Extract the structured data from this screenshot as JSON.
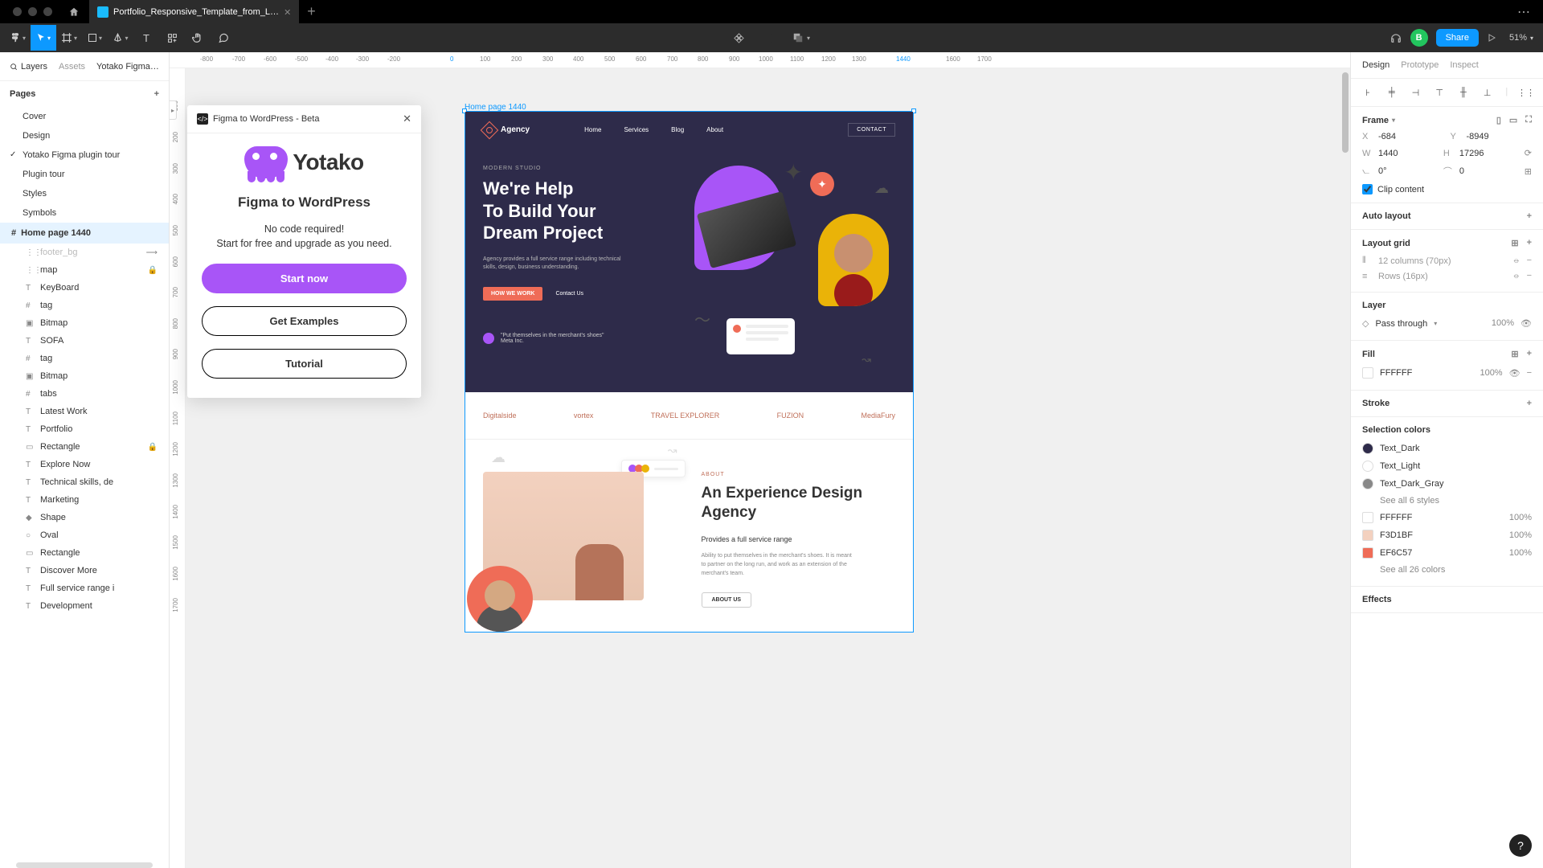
{
  "tabs": {
    "file_name": "Portfolio_Responsive_Template_from_L…"
  },
  "toolbar": {
    "share": "Share",
    "zoom": "51%",
    "avatar": "B"
  },
  "left": {
    "tab_layers": "Layers",
    "tab_assets": "Assets",
    "doc_name": "Yotako Figma p…",
    "pages_label": "Pages",
    "pages": [
      "Cover",
      "Design",
      "Yotako Figma plugin tour",
      "Plugin tour",
      "Styles",
      "Symbols"
    ],
    "frame": "Home page 1440",
    "layers": [
      {
        "icon": "⋮⋮",
        "name": "footer_bg",
        "dim": true,
        "flag": "⟶"
      },
      {
        "icon": "⋮⋮",
        "name": "map",
        "lock": true
      },
      {
        "icon": "T",
        "name": "KeyBoard"
      },
      {
        "icon": "#",
        "name": "tag"
      },
      {
        "icon": "▣",
        "name": "Bitmap"
      },
      {
        "icon": "T",
        "name": "SOFA"
      },
      {
        "icon": "#",
        "name": "tag"
      },
      {
        "icon": "▣",
        "name": "Bitmap"
      },
      {
        "icon": "#",
        "name": "tabs"
      },
      {
        "icon": "T",
        "name": "Latest Work"
      },
      {
        "icon": "T",
        "name": "Portfolio"
      },
      {
        "icon": "▭",
        "name": "Rectangle",
        "lock": true
      },
      {
        "icon": "T",
        "name": "Explore Now"
      },
      {
        "icon": "T",
        "name": "Technical skills, de"
      },
      {
        "icon": "T",
        "name": "Marketing"
      },
      {
        "icon": "◆",
        "name": "Shape"
      },
      {
        "icon": "○",
        "name": "Oval"
      },
      {
        "icon": "▭",
        "name": "Rectangle"
      },
      {
        "icon": "T",
        "name": "Discover More"
      },
      {
        "icon": "T",
        "name": "Full service range i"
      },
      {
        "icon": "T",
        "name": "Development"
      }
    ]
  },
  "ruler_h": [
    {
      "v": "-800",
      "p": 38
    },
    {
      "v": "-700",
      "p": 78
    },
    {
      "v": "-600",
      "p": 117
    },
    {
      "v": "-500",
      "p": 156
    },
    {
      "v": "-400",
      "p": 194
    },
    {
      "v": "-300",
      "p": 232
    },
    {
      "v": "-200",
      "p": 271
    },
    {
      "v": "0",
      "p": 349,
      "sel": true
    },
    {
      "v": "100",
      "p": 386
    },
    {
      "v": "200",
      "p": 425
    },
    {
      "v": "300",
      "p": 464
    },
    {
      "v": "400",
      "p": 502
    },
    {
      "v": "500",
      "p": 541
    },
    {
      "v": "600",
      "p": 580
    },
    {
      "v": "700",
      "p": 619
    },
    {
      "v": "800",
      "p": 657
    },
    {
      "v": "900",
      "p": 696
    },
    {
      "v": "1000",
      "p": 733
    },
    {
      "v": "1100",
      "p": 772
    },
    {
      "v": "1200",
      "p": 811
    },
    {
      "v": "1300",
      "p": 849
    },
    {
      "v": "1440",
      "p": 904,
      "sel": true
    },
    {
      "v": "1600",
      "p": 966
    },
    {
      "v": "1700",
      "p": 1005
    }
  ],
  "ruler_v": [
    {
      "v": "100",
      "p": 40
    },
    {
      "v": "200",
      "p": 79
    },
    {
      "v": "300",
      "p": 118
    },
    {
      "v": "400",
      "p": 156
    },
    {
      "v": "500",
      "p": 195
    },
    {
      "v": "600",
      "p": 234
    },
    {
      "v": "700",
      "p": 272
    },
    {
      "v": "800",
      "p": 311
    },
    {
      "v": "900",
      "p": 349
    },
    {
      "v": "1000",
      "p": 388
    },
    {
      "v": "1100",
      "p": 427
    },
    {
      "v": "1200",
      "p": 465
    },
    {
      "v": "1300",
      "p": 504
    },
    {
      "v": "1400",
      "p": 543
    },
    {
      "v": "1500",
      "p": 581
    },
    {
      "v": "1600",
      "p": 620
    },
    {
      "v": "1700",
      "p": 659
    }
  ],
  "plugin": {
    "title_bar": "Figma to WordPress - Beta",
    "brand": "Yotako",
    "heading": "Figma to WordPress",
    "line1": "No code required!",
    "line2": "Start for free and upgrade as you need.",
    "btn_start": "Start now",
    "btn_examples": "Get Examples",
    "btn_tutorial": "Tutorial"
  },
  "artboard": {
    "frame_label": "Home page 1440",
    "brand": "Agency",
    "nav": [
      "Home",
      "Services",
      "Blog",
      "About"
    ],
    "contact": "CONTACT",
    "kicker": "MODERN STUDIO",
    "h1a": "We're Help",
    "h1b": "To Build Your",
    "h1c": "Dream Project",
    "p": "Agency provides a full service range including technical skills, design, business understanding.",
    "cta1": "HOW WE WORK",
    "cta2": "Contact Us",
    "quote": "\"Put themselves in the merchant's shoes\"",
    "quote_by": "Meta Inc.",
    "logos": [
      "Digitalside",
      "vortex",
      "TRAVEL EXPLORER",
      "FUZION",
      "MediaFury"
    ],
    "about_kick": "ABOUT",
    "about_h2": "An Experience Design Agency",
    "about_sub": "Provides a full service range",
    "about_p": "Ability to put themselves in the merchant's shoes. It is meant to partner on the long run, and work as an extension of the merchant's team.",
    "about_btn": "ABOUT US"
  },
  "right": {
    "tab_design": "Design",
    "tab_proto": "Prototype",
    "tab_inspect": "Inspect",
    "frame_label": "Frame",
    "x": "-684",
    "y": "-8949",
    "w": "1440",
    "h": "17296",
    "rot": "0°",
    "rad": "0",
    "clip": "Clip content",
    "auto_layout": "Auto layout",
    "layout_grid": "Layout grid",
    "grid1": "12 columns (70px)",
    "grid2": "Rows (16px)",
    "layer": "Layer",
    "pass": "Pass through",
    "opacity": "100%",
    "fill": "Fill",
    "fill_hex": "FFFFFF",
    "fill_op": "100%",
    "stroke": "Stroke",
    "sel_colors": "Selection colors",
    "c1": "Text_Dark",
    "c2": "Text_Light",
    "c3": "Text_Dark_Gray",
    "see6": "See all 6 styles",
    "sc1": "FFFFFF",
    "sc2": "F3D1BF",
    "sc3": "EF6C57",
    "scp": "100%",
    "see26": "See all 26 colors",
    "effects": "Effects"
  }
}
